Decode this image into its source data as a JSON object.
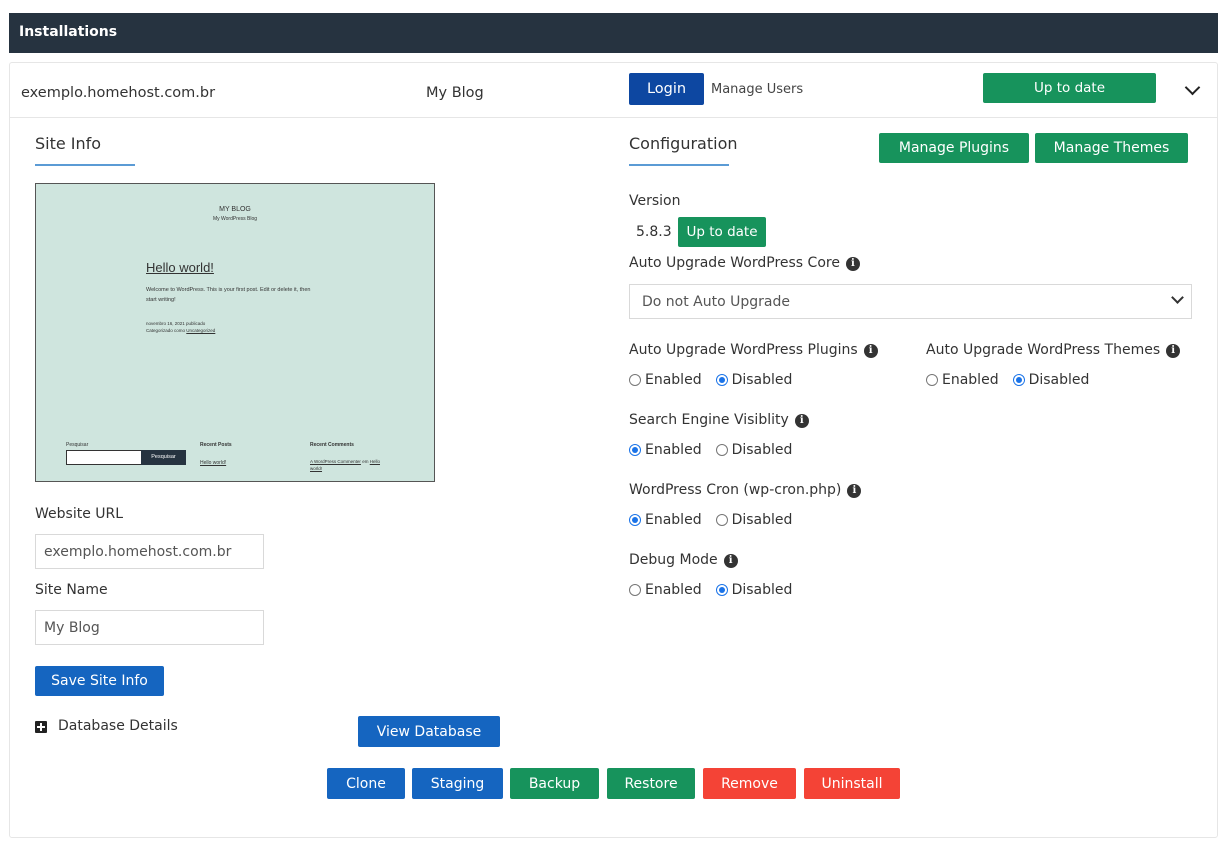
{
  "topbar": {
    "title": "Installations"
  },
  "installation": {
    "domain": "exemplo.homehost.com.br",
    "site_name": "My Blog",
    "login_label": "Login",
    "manage_users_label": "Manage Users",
    "status_label": "Up to date"
  },
  "site_info": {
    "title": "Site Info",
    "preview": {
      "blog_title": "MY BLOG",
      "blog_tagline": "My WordPress Blog",
      "post_title": "Hello world!",
      "post_body_1": "Welcome to WordPress. This is your first post. Edit or delete it, then",
      "post_body_2": "start writing!",
      "post_meta_1": "novembro 16, 2021 publicado",
      "post_meta_2": "Categorizado como",
      "post_meta_link": "Uncategorized",
      "search_label": "Pesquisar",
      "search_button": "Pesquisar",
      "recent_posts_heading": "Recent Posts",
      "recent_post_link": "Hello world!",
      "recent_comments_heading": "Recent Comments",
      "recent_comment_author": "A WordPress Commenter",
      "recent_comment_on": "em",
      "recent_comment_post_1": "Hello",
      "recent_comment_post_2": "world!"
    },
    "website_url_label": "Website URL",
    "website_url_value": "exemplo.homehost.com.br",
    "site_name_label": "Site Name",
    "site_name_value": "My Blog",
    "save_label": "Save Site Info",
    "database_details_label": "Database Details",
    "view_database_label": "View Database"
  },
  "configuration": {
    "title": "Configuration",
    "manage_plugins_label": "Manage Plugins",
    "manage_themes_label": "Manage Themes",
    "version_label": "Version",
    "version_value": "5.8.3",
    "version_status": "Up to date",
    "auto_core_label": "Auto Upgrade WordPress Core",
    "auto_core_value": "Do not Auto Upgrade",
    "auto_plugins_label": "Auto Upgrade WordPress Plugins",
    "auto_themes_label": "Auto Upgrade WordPress Themes",
    "search_engine_label": "Search Engine Visiblity",
    "cron_label": "WordPress Cron (wp-cron.php)",
    "debug_label": "Debug Mode",
    "enabled_label": "Enabled",
    "disabled_label": "Disabled",
    "info_glyph": "i"
  },
  "actions": {
    "clone": "Clone",
    "staging": "Staging",
    "backup": "Backup",
    "restore": "Restore",
    "remove": "Remove",
    "uninstall": "Uninstall"
  },
  "colors": {
    "topbar": "#263340",
    "primary_blue": "#1565c0",
    "login_blue": "#0d47a1",
    "success_green": "#17935c",
    "danger_red": "#f44336",
    "radio_selected": "#1a73e8"
  },
  "icons": {
    "expand_toggle": "chevron-down-icon",
    "info": "info-icon",
    "database_expand": "plus-square-icon"
  }
}
